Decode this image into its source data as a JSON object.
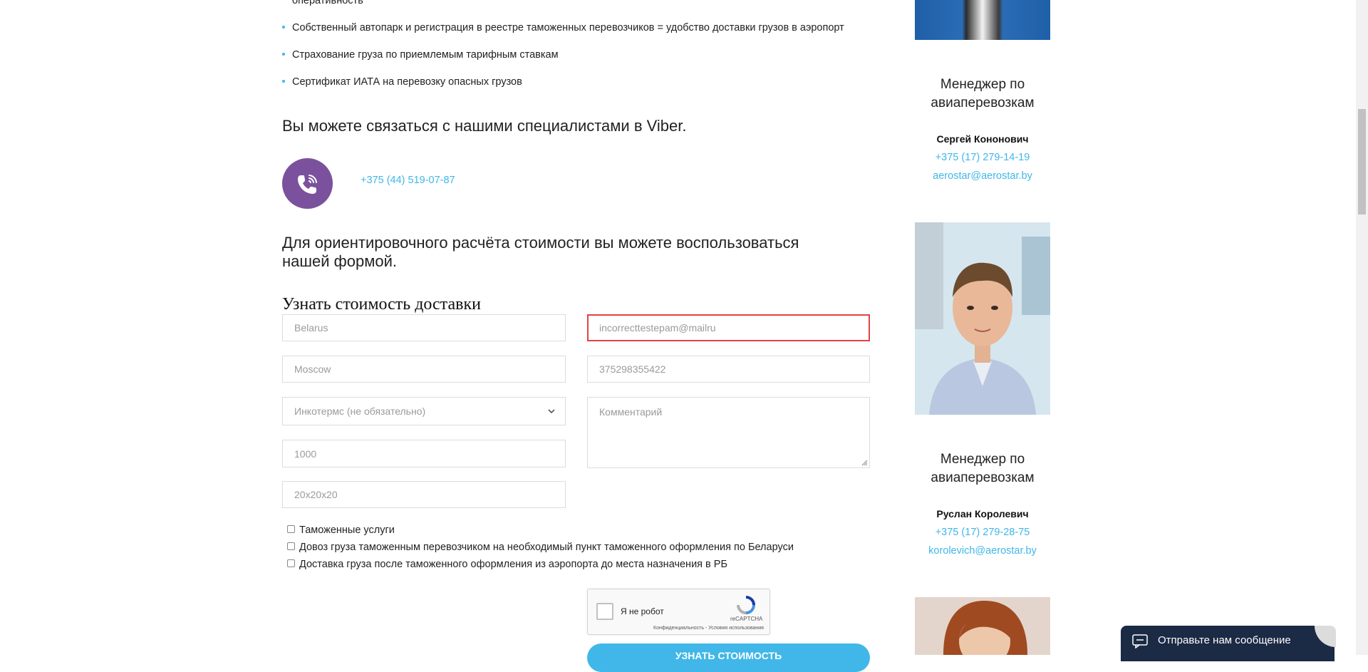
{
  "bullets": [
    {
      "text": "оперативность",
      "continuation": true
    },
    {
      "text": "Собственный автопарк и регистрация в реестре таможенных перевозчиков = удобство доставки грузов в аэропорт"
    },
    {
      "text": "Страхование груза по приемлемым тарифным ставкам"
    },
    {
      "text": "Сертификат ИАТА на перевозку опасных грузов"
    }
  ],
  "viber": {
    "heading": "Вы можете связаться с нашими специалистами в Viber.",
    "phone": "+375 (44) 519-07-87",
    "icon": "viber-phone-icon",
    "color": "#7b519d"
  },
  "calc_heading": "Для ориентировочного расчёта стоимости вы можете воспользоваться нашей формой.",
  "form": {
    "title": "Узнать стоимость доставки",
    "from_country": {
      "placeholder": "Belarus"
    },
    "from_city": {
      "placeholder": "Moscow"
    },
    "incoterms": {
      "selected": "Инкотермс (не обязательно)"
    },
    "weight": {
      "placeholder": "1000"
    },
    "dimensions": {
      "placeholder": "20x20x20"
    },
    "email": {
      "value": "incorrecttestepam@mailru"
    },
    "phone": {
      "placeholder": "375298355422"
    },
    "comment": {
      "placeholder": "Комментарий"
    },
    "checkboxes": [
      {
        "label": "Таможенные услуги",
        "checked": false
      },
      {
        "label": "Довоз груза таможенным перевозчиком на необходимый пункт таможенного оформления по Беларуси",
        "checked": false
      },
      {
        "label": "Доставка груза после таможенного оформления из аэропорта до места назначения в РБ",
        "checked": false
      }
    ],
    "captcha": {
      "label": "Я не робот",
      "brand": "reCAPTCHA",
      "terms": "Конфиденциальность - Условия использования"
    },
    "submit_label": "УЗНАТЬ СТОИМОСТЬ"
  },
  "managers": [
    {
      "title": "Менеджер по авиаперевозкам",
      "name": "Сергей Кононович",
      "phone": "+375 (17) 279-14-19",
      "email": "aerostar@aerostar.by"
    },
    {
      "title": "Менеджер по авиаперевозкам",
      "name": "Руслан Королевич",
      "phone": "+375 (17) 279-28-75",
      "email": "korolevich@aerostar.by"
    }
  ],
  "chat": {
    "label": "Отправьте нам сообщение",
    "icon": "message-icon"
  },
  "colors": {
    "accent": "#40b7e8",
    "error": "#e04444",
    "chat_bg": "#1b2a45"
  }
}
